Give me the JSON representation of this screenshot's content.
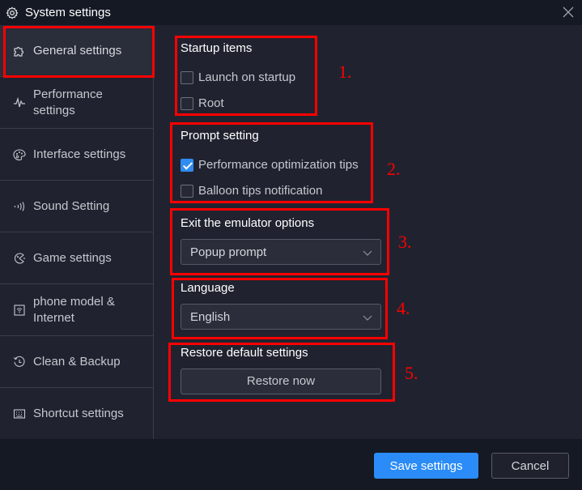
{
  "window": {
    "title": "System settings",
    "icon": "gear-icon",
    "close_icon": "close-icon"
  },
  "sidebar": {
    "items": [
      {
        "label": "General settings",
        "icon": "puzzle-icon",
        "active": true
      },
      {
        "label": "Performance settings",
        "icon": "pulse-icon",
        "active": false
      },
      {
        "label": "Interface settings",
        "icon": "palette-icon",
        "active": false
      },
      {
        "label": "Sound Setting",
        "icon": "sound-wave-icon",
        "active": false
      },
      {
        "label": "Game settings",
        "icon": "gamepad-icon",
        "active": false
      },
      {
        "label": "phone model & Internet",
        "icon": "wifi-phone-icon",
        "active": false
      },
      {
        "label": "Clean & Backup",
        "icon": "history-icon",
        "active": false
      },
      {
        "label": "Shortcut settings",
        "icon": "keyboard-icon",
        "active": false
      }
    ]
  },
  "content": {
    "startup": {
      "title": "Startup items",
      "options": [
        {
          "label": "Launch on startup",
          "checked": false
        },
        {
          "label": "Root",
          "checked": false
        }
      ]
    },
    "prompt": {
      "title": "Prompt setting",
      "options": [
        {
          "label": "Performance optimization tips",
          "checked": true
        },
        {
          "label": "Balloon tips notification",
          "checked": false
        }
      ]
    },
    "exit": {
      "title": "Exit the emulator options",
      "selected": "Popup prompt"
    },
    "language": {
      "title": "Language",
      "selected": "English"
    },
    "restore": {
      "title": "Restore default settings",
      "button_label": "Restore now"
    }
  },
  "annotations": [
    "1.",
    "2.",
    "3.",
    "4.",
    "5."
  ],
  "footer": {
    "save_label": "Save settings",
    "cancel_label": "Cancel"
  },
  "colors": {
    "accent": "#2b8cf7",
    "annotation": "#ff0000",
    "background": "#20232f",
    "titlebar": "#151924"
  }
}
